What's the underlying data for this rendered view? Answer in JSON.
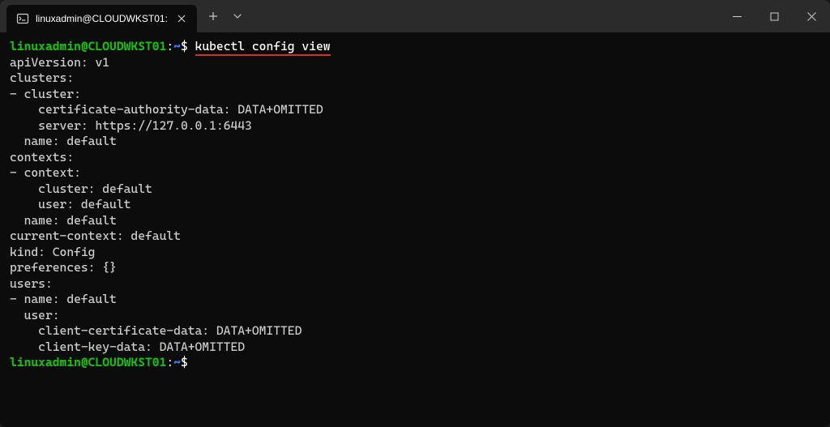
{
  "tab": {
    "title": "linuxadmin@CLOUDWKST01:"
  },
  "prompt": {
    "user_host": "linuxadmin@CLOUDWKST01",
    "colon": ":",
    "path": "~",
    "dollar": "$"
  },
  "command": "kubectl config view",
  "output_lines": [
    "apiVersion: v1",
    "clusters:",
    "- cluster:",
    "    certificate-authority-data: DATA+OMITTED",
    "    server: https://127.0.0.1:6443",
    "  name: default",
    "contexts:",
    "- context:",
    "    cluster: default",
    "    user: default",
    "  name: default",
    "current-context: default",
    "kind: Config",
    "preferences: {}",
    "users:",
    "- name: default",
    "  user:",
    "    client-certificate-data: DATA+OMITTED",
    "    client-key-data: DATA+OMITTED"
  ]
}
